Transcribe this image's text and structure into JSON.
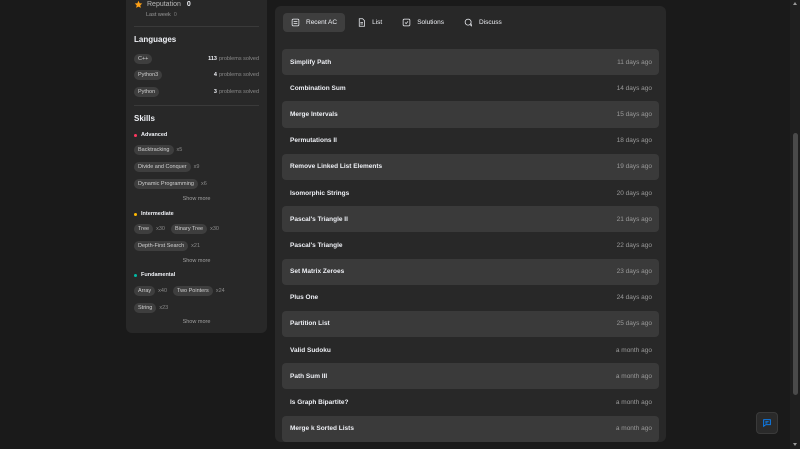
{
  "colors": {
    "star": "#ffa116",
    "advanced": "#ff375f",
    "intermediate": "#ffb800",
    "fundamental": "#00b8a3",
    "fab_icon": "#0a84ff"
  },
  "profile": {
    "reputation_label": "Reputation",
    "reputation_value": "0",
    "last_week_label": "Last week",
    "last_week_value": "0"
  },
  "languages": {
    "title": "Languages",
    "items": [
      {
        "name": "C++",
        "count": "113",
        "suffix": "problems solved"
      },
      {
        "name": "Python3",
        "count": "4",
        "suffix": "problems solved"
      },
      {
        "name": "Python",
        "count": "3",
        "suffix": "problems solved"
      }
    ]
  },
  "skills": {
    "title": "Skills",
    "advanced": {
      "label": "Advanced",
      "items": [
        {
          "name": "Backtracking",
          "count": "x5"
        },
        {
          "name": "Divide and Conquer",
          "count": "x9"
        },
        {
          "name": "Dynamic Programming",
          "count": "x6"
        }
      ],
      "show_more": "Show more"
    },
    "intermediate": {
      "label": "Intermediate",
      "items": [
        {
          "name": "Tree",
          "count": "x30"
        },
        {
          "name": "Binary Tree",
          "count": "x30"
        },
        {
          "name": "Depth-First Search",
          "count": "x21"
        }
      ],
      "show_more": "Show more"
    },
    "fundamental": {
      "label": "Fundamental",
      "items": [
        {
          "name": "Array",
          "count": "x40"
        },
        {
          "name": "Two Pointers",
          "count": "x24"
        },
        {
          "name": "String",
          "count": "x23"
        }
      ],
      "show_more": "Show more"
    }
  },
  "tabs": [
    {
      "label": "Recent AC",
      "icon": "list-box-icon"
    },
    {
      "label": "List",
      "icon": "document-icon"
    },
    {
      "label": "Solutions",
      "icon": "checkbox-icon"
    },
    {
      "label": "Discuss",
      "icon": "chat-icon"
    }
  ],
  "recent": [
    {
      "title": "Simplify Path",
      "time": "11 days ago"
    },
    {
      "title": "Combination Sum",
      "time": "14 days ago"
    },
    {
      "title": "Merge Intervals",
      "time": "15 days ago"
    },
    {
      "title": "Permutations II",
      "time": "18 days ago"
    },
    {
      "title": "Remove Linked List Elements",
      "time": "19 days ago"
    },
    {
      "title": "Isomorphic Strings",
      "time": "20 days ago"
    },
    {
      "title": "Pascal's Triangle II",
      "time": "21 days ago"
    },
    {
      "title": "Pascal's Triangle",
      "time": "22 days ago"
    },
    {
      "title": "Set Matrix Zeroes",
      "time": "23 days ago"
    },
    {
      "title": "Plus One",
      "time": "24 days ago"
    },
    {
      "title": "Partition List",
      "time": "25 days ago"
    },
    {
      "title": "Valid Sudoku",
      "time": "a month ago"
    },
    {
      "title": "Path Sum III",
      "time": "a month ago"
    },
    {
      "title": "Is Graph Bipartite?",
      "time": "a month ago"
    },
    {
      "title": "Merge k Sorted Lists",
      "time": "a month ago"
    }
  ]
}
